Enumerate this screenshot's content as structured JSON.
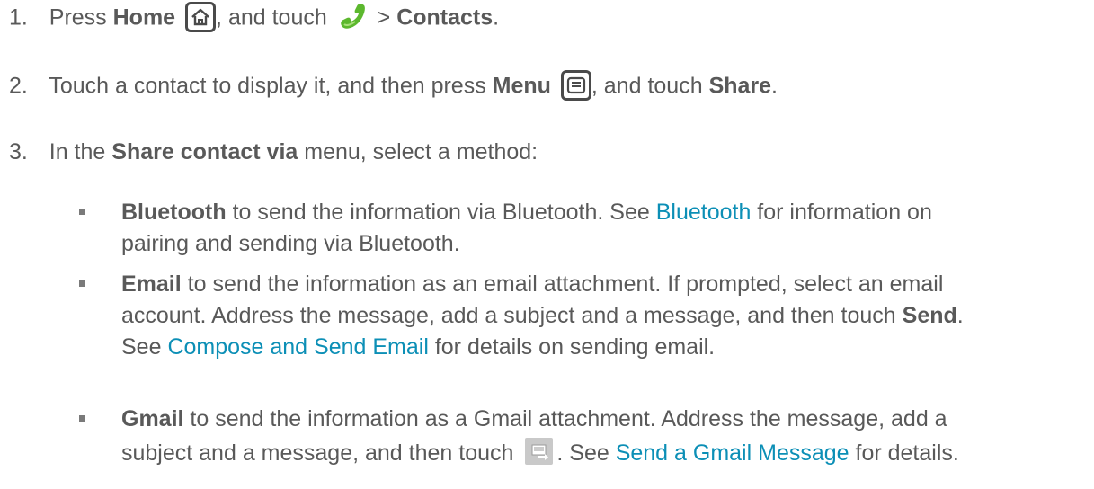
{
  "steps": [
    {
      "num": "1.",
      "parts": {
        "press": "Press ",
        "home": "Home",
        "and_touch": ", and touch ",
        "gt": " > ",
        "contacts": "Contacts",
        "end": "."
      }
    },
    {
      "num": "2.",
      "parts": {
        "intro": "Touch a contact to display it, and then press ",
        "menu": "Menu",
        "and_touch": ", and touch ",
        "share": "Share",
        "end": "."
      }
    },
    {
      "num": "3.",
      "parts": {
        "in_the": "In the ",
        "share_via": "Share contact via",
        "rest": " menu, select a method:"
      }
    }
  ],
  "methods": [
    {
      "name": "Bluetooth",
      "line1_a": " to send the information via Bluetooth. See ",
      "link": "Bluetooth",
      "line1_b": " for information on",
      "line2": "pairing and sending via Bluetooth."
    },
    {
      "name": "Email",
      "line1": " to send the information as an email attachment. If prompted, select an email",
      "line2_a": "account. Address the message, add a subject and a message, and then touch ",
      "send": "Send",
      "line2_b": ".",
      "line3_a": "See ",
      "link": "Compose and Send Email",
      "line3_b": " for details on sending email."
    },
    {
      "name": "Gmail",
      "line1": " to send the information as a Gmail attachment. Address the message, add a",
      "line2_a": "subject and a message, and then touch",
      "line2_b": ". See ",
      "link": "Send a Gmail Message",
      "line2_c": " for details."
    }
  ],
  "icons": {
    "home": "home-icon",
    "phone": "phone-icon",
    "menu": "menu-icon",
    "send": "send-icon"
  },
  "colors": {
    "text": "#595959",
    "link": "#0c8fb6",
    "phone": "#5cb82e"
  }
}
